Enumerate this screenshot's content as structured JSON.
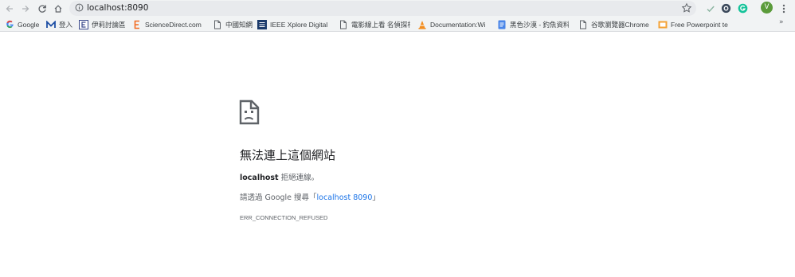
{
  "toolbar": {
    "url": "localhost:8090",
    "avatar_letter": "V",
    "colors": {
      "avatar": "#5b9b3b",
      "grammarly": "#15c39a"
    }
  },
  "bookmarks": [
    {
      "label": "Google",
      "icon": "google-g-icon"
    },
    {
      "label": "登入",
      "icon": "m-logo-icon"
    },
    {
      "label": "伊莉討論區",
      "icon": "e-logo-icon"
    },
    {
      "label": "ScienceDirect.com |",
      "icon": "elsevier-icon"
    },
    {
      "label": "中國知網",
      "icon": "page-icon"
    },
    {
      "label": "IEEE Xplore Digital L",
      "icon": "ieee-icon"
    },
    {
      "label": "電影線上看 名偵探柯",
      "icon": "page-icon"
    },
    {
      "label": "Documentation:Wi",
      "icon": "vlc-cone-icon"
    },
    {
      "label": "黑色沙漠 - 釣魚資料",
      "icon": "docs-icon"
    },
    {
      "label": "谷歌瀏覽器Chrome",
      "icon": "page-icon"
    },
    {
      "label": "Free Powerpoint te",
      "icon": "slides-icon"
    }
  ],
  "error": {
    "title": "無法連上這個網站",
    "host": "localhost",
    "refused_text": " 拒絕連線。",
    "search_prefix": "請透過 Google 搜尋「",
    "search_link": "localhost 8090",
    "search_suffix": "」",
    "code": "ERR_CONNECTION_REFUSED"
  }
}
